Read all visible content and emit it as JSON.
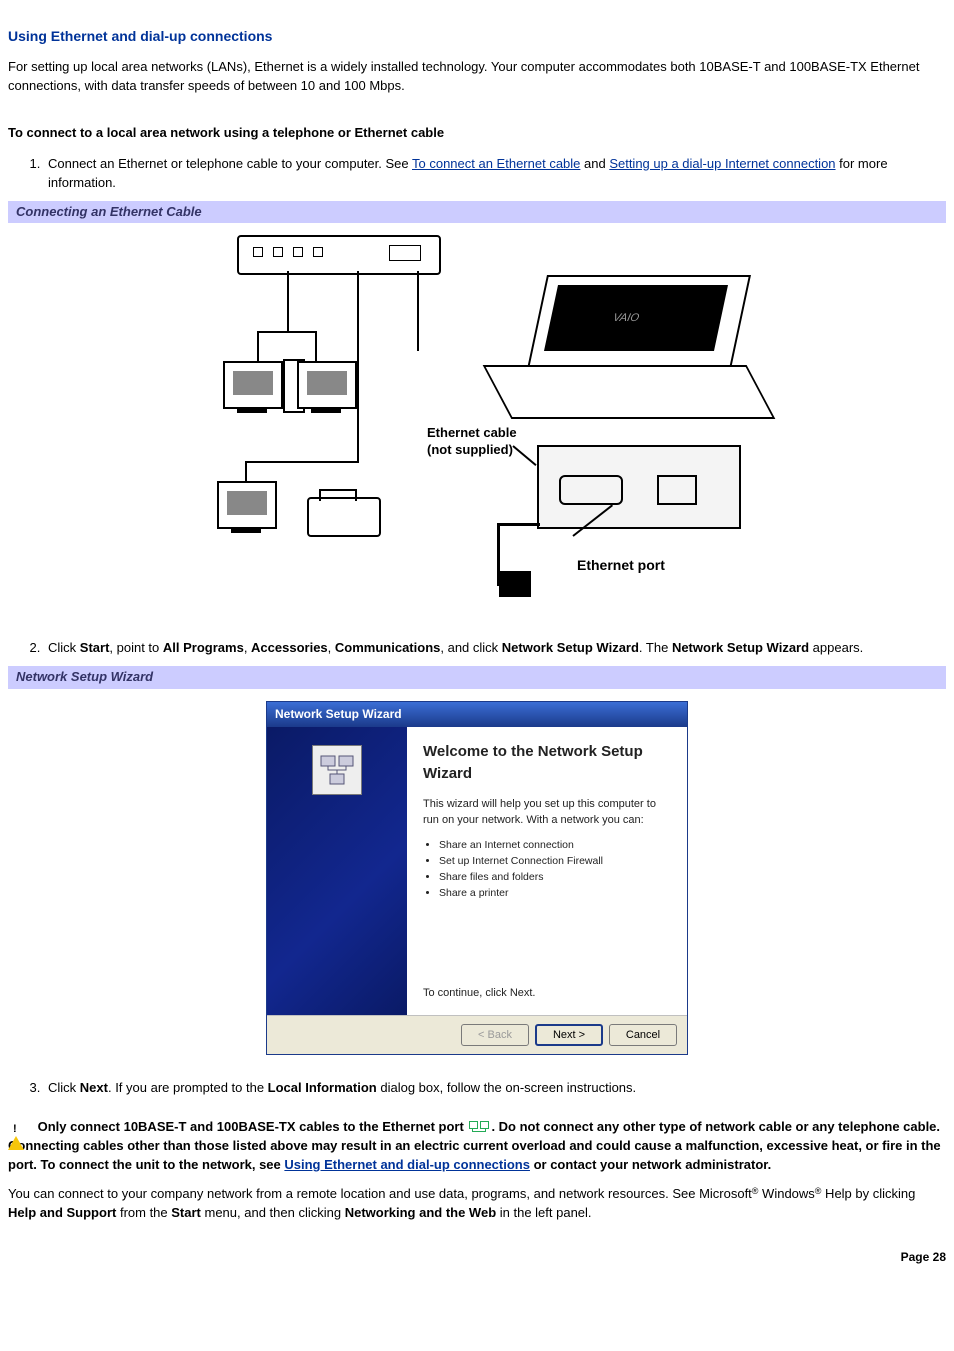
{
  "title": "Using Ethernet and dial-up connections",
  "intro": "For setting up local area networks (LANs), Ethernet is a widely installed technology. Your computer accommodates both 10BASE-T and 100BASE-TX Ethernet connections, with data transfer speeds of between 10 and 100 Mbps.",
  "subhead1": "To connect to a local area network using a telephone or Ethernet cable",
  "step1_pre": "Connect an Ethernet or telephone cable to your computer. See ",
  "step1_link1": "To connect an Ethernet cable",
  "step1_mid": " and ",
  "step1_link2": "Setting up a dial-up Internet connection",
  "step1_post": " for more information.",
  "caption1": "Connecting an Ethernet Cable",
  "fig1": {
    "logo": "VAIO",
    "label_cable": "Ethernet cable (not supplied)",
    "label_port": "Ethernet port"
  },
  "step2_a": "Click ",
  "step2_start": "Start",
  "step2_b": ", point to ",
  "step2_allprograms": "All Programs",
  "step2_c": ", ",
  "step2_accessories": "Accessories",
  "step2_d": ", ",
  "step2_comm": "Communications",
  "step2_e": ", and click ",
  "step2_nsw": "Network Setup Wizard",
  "step2_f": ". The ",
  "step2_nsw2": "Network Setup Wizard",
  "step2_g": " appears.",
  "caption2": "Network Setup Wizard",
  "dialog": {
    "title": "Network Setup Wizard",
    "heading": "Welcome to the Network Setup Wizard",
    "lead": "This wizard will help you set up this computer to run on your network. With a network you can:",
    "bullets": [
      "Share an Internet connection",
      "Set up Internet Connection Firewall",
      "Share files and folders",
      "Share a printer"
    ],
    "continue": "To continue, click Next.",
    "btn_back": "< Back",
    "btn_next": "Next >",
    "btn_cancel": "Cancel"
  },
  "step3_a": "Click ",
  "step3_next": "Next",
  "step3_b": ". If you are prompted to the ",
  "step3_local": "Local Information",
  "step3_c": " dialog box, follow the on-screen instructions.",
  "warn_a": "Only connect 10BASE-T and 100BASE-TX cables to the Ethernet port ",
  "warn_b": ". Do not connect any other type of network cable or any telephone cable. Connecting cables other than those listed above may result in an electric current overload and could cause a malfunction, excessive heat, or fire in the port. To connect the unit to the network, see ",
  "warn_link": "Using Ethernet and dial-up connections",
  "warn_c": " or contact your network administrator.",
  "tail_a": "You can connect to your company network from a remote location and use data, programs, and network resources. See Microsoft",
  "tail_b": " Windows",
  "tail_c": " Help by clicking ",
  "tail_help": "Help and Support",
  "tail_d": " from the ",
  "tail_start": "Start",
  "tail_e": " menu, and then clicking ",
  "tail_netweb": "Networking and the Web",
  "tail_f": " in the left panel.",
  "page": "Page 28"
}
